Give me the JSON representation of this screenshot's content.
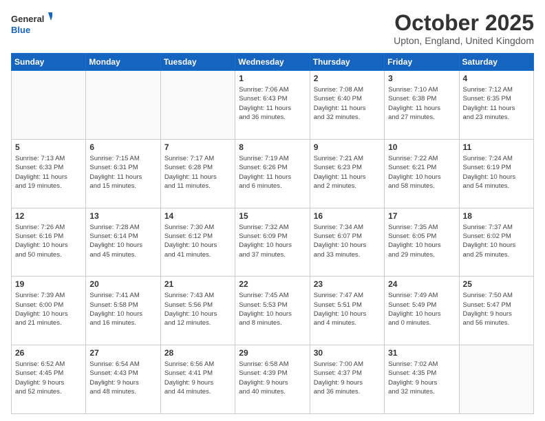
{
  "logo": {
    "general": "General",
    "blue": "Blue"
  },
  "header": {
    "month": "October 2025",
    "location": "Upton, England, United Kingdom"
  },
  "weekdays": [
    "Sunday",
    "Monday",
    "Tuesday",
    "Wednesday",
    "Thursday",
    "Friday",
    "Saturday"
  ],
  "rows": [
    [
      {
        "day": "",
        "text": ""
      },
      {
        "day": "",
        "text": ""
      },
      {
        "day": "",
        "text": ""
      },
      {
        "day": "1",
        "text": "Sunrise: 7:06 AM\nSunset: 6:43 PM\nDaylight: 11 hours\nand 36 minutes."
      },
      {
        "day": "2",
        "text": "Sunrise: 7:08 AM\nSunset: 6:40 PM\nDaylight: 11 hours\nand 32 minutes."
      },
      {
        "day": "3",
        "text": "Sunrise: 7:10 AM\nSunset: 6:38 PM\nDaylight: 11 hours\nand 27 minutes."
      },
      {
        "day": "4",
        "text": "Sunrise: 7:12 AM\nSunset: 6:35 PM\nDaylight: 11 hours\nand 23 minutes."
      }
    ],
    [
      {
        "day": "5",
        "text": "Sunrise: 7:13 AM\nSunset: 6:33 PM\nDaylight: 11 hours\nand 19 minutes."
      },
      {
        "day": "6",
        "text": "Sunrise: 7:15 AM\nSunset: 6:31 PM\nDaylight: 11 hours\nand 15 minutes."
      },
      {
        "day": "7",
        "text": "Sunrise: 7:17 AM\nSunset: 6:28 PM\nDaylight: 11 hours\nand 11 minutes."
      },
      {
        "day": "8",
        "text": "Sunrise: 7:19 AM\nSunset: 6:26 PM\nDaylight: 11 hours\nand 6 minutes."
      },
      {
        "day": "9",
        "text": "Sunrise: 7:21 AM\nSunset: 6:23 PM\nDaylight: 11 hours\nand 2 minutes."
      },
      {
        "day": "10",
        "text": "Sunrise: 7:22 AM\nSunset: 6:21 PM\nDaylight: 10 hours\nand 58 minutes."
      },
      {
        "day": "11",
        "text": "Sunrise: 7:24 AM\nSunset: 6:19 PM\nDaylight: 10 hours\nand 54 minutes."
      }
    ],
    [
      {
        "day": "12",
        "text": "Sunrise: 7:26 AM\nSunset: 6:16 PM\nDaylight: 10 hours\nand 50 minutes."
      },
      {
        "day": "13",
        "text": "Sunrise: 7:28 AM\nSunset: 6:14 PM\nDaylight: 10 hours\nand 45 minutes."
      },
      {
        "day": "14",
        "text": "Sunrise: 7:30 AM\nSunset: 6:12 PM\nDaylight: 10 hours\nand 41 minutes."
      },
      {
        "day": "15",
        "text": "Sunrise: 7:32 AM\nSunset: 6:09 PM\nDaylight: 10 hours\nand 37 minutes."
      },
      {
        "day": "16",
        "text": "Sunrise: 7:34 AM\nSunset: 6:07 PM\nDaylight: 10 hours\nand 33 minutes."
      },
      {
        "day": "17",
        "text": "Sunrise: 7:35 AM\nSunset: 6:05 PM\nDaylight: 10 hours\nand 29 minutes."
      },
      {
        "day": "18",
        "text": "Sunrise: 7:37 AM\nSunset: 6:02 PM\nDaylight: 10 hours\nand 25 minutes."
      }
    ],
    [
      {
        "day": "19",
        "text": "Sunrise: 7:39 AM\nSunset: 6:00 PM\nDaylight: 10 hours\nand 21 minutes."
      },
      {
        "day": "20",
        "text": "Sunrise: 7:41 AM\nSunset: 5:58 PM\nDaylight: 10 hours\nand 16 minutes."
      },
      {
        "day": "21",
        "text": "Sunrise: 7:43 AM\nSunset: 5:56 PM\nDaylight: 10 hours\nand 12 minutes."
      },
      {
        "day": "22",
        "text": "Sunrise: 7:45 AM\nSunset: 5:53 PM\nDaylight: 10 hours\nand 8 minutes."
      },
      {
        "day": "23",
        "text": "Sunrise: 7:47 AM\nSunset: 5:51 PM\nDaylight: 10 hours\nand 4 minutes."
      },
      {
        "day": "24",
        "text": "Sunrise: 7:49 AM\nSunset: 5:49 PM\nDaylight: 10 hours\nand 0 minutes."
      },
      {
        "day": "25",
        "text": "Sunrise: 7:50 AM\nSunset: 5:47 PM\nDaylight: 9 hours\nand 56 minutes."
      }
    ],
    [
      {
        "day": "26",
        "text": "Sunrise: 6:52 AM\nSunset: 4:45 PM\nDaylight: 9 hours\nand 52 minutes."
      },
      {
        "day": "27",
        "text": "Sunrise: 6:54 AM\nSunset: 4:43 PM\nDaylight: 9 hours\nand 48 minutes."
      },
      {
        "day": "28",
        "text": "Sunrise: 6:56 AM\nSunset: 4:41 PM\nDaylight: 9 hours\nand 44 minutes."
      },
      {
        "day": "29",
        "text": "Sunrise: 6:58 AM\nSunset: 4:39 PM\nDaylight: 9 hours\nand 40 minutes."
      },
      {
        "day": "30",
        "text": "Sunrise: 7:00 AM\nSunset: 4:37 PM\nDaylight: 9 hours\nand 36 minutes."
      },
      {
        "day": "31",
        "text": "Sunrise: 7:02 AM\nSunset: 4:35 PM\nDaylight: 9 hours\nand 32 minutes."
      },
      {
        "day": "",
        "text": ""
      }
    ]
  ]
}
